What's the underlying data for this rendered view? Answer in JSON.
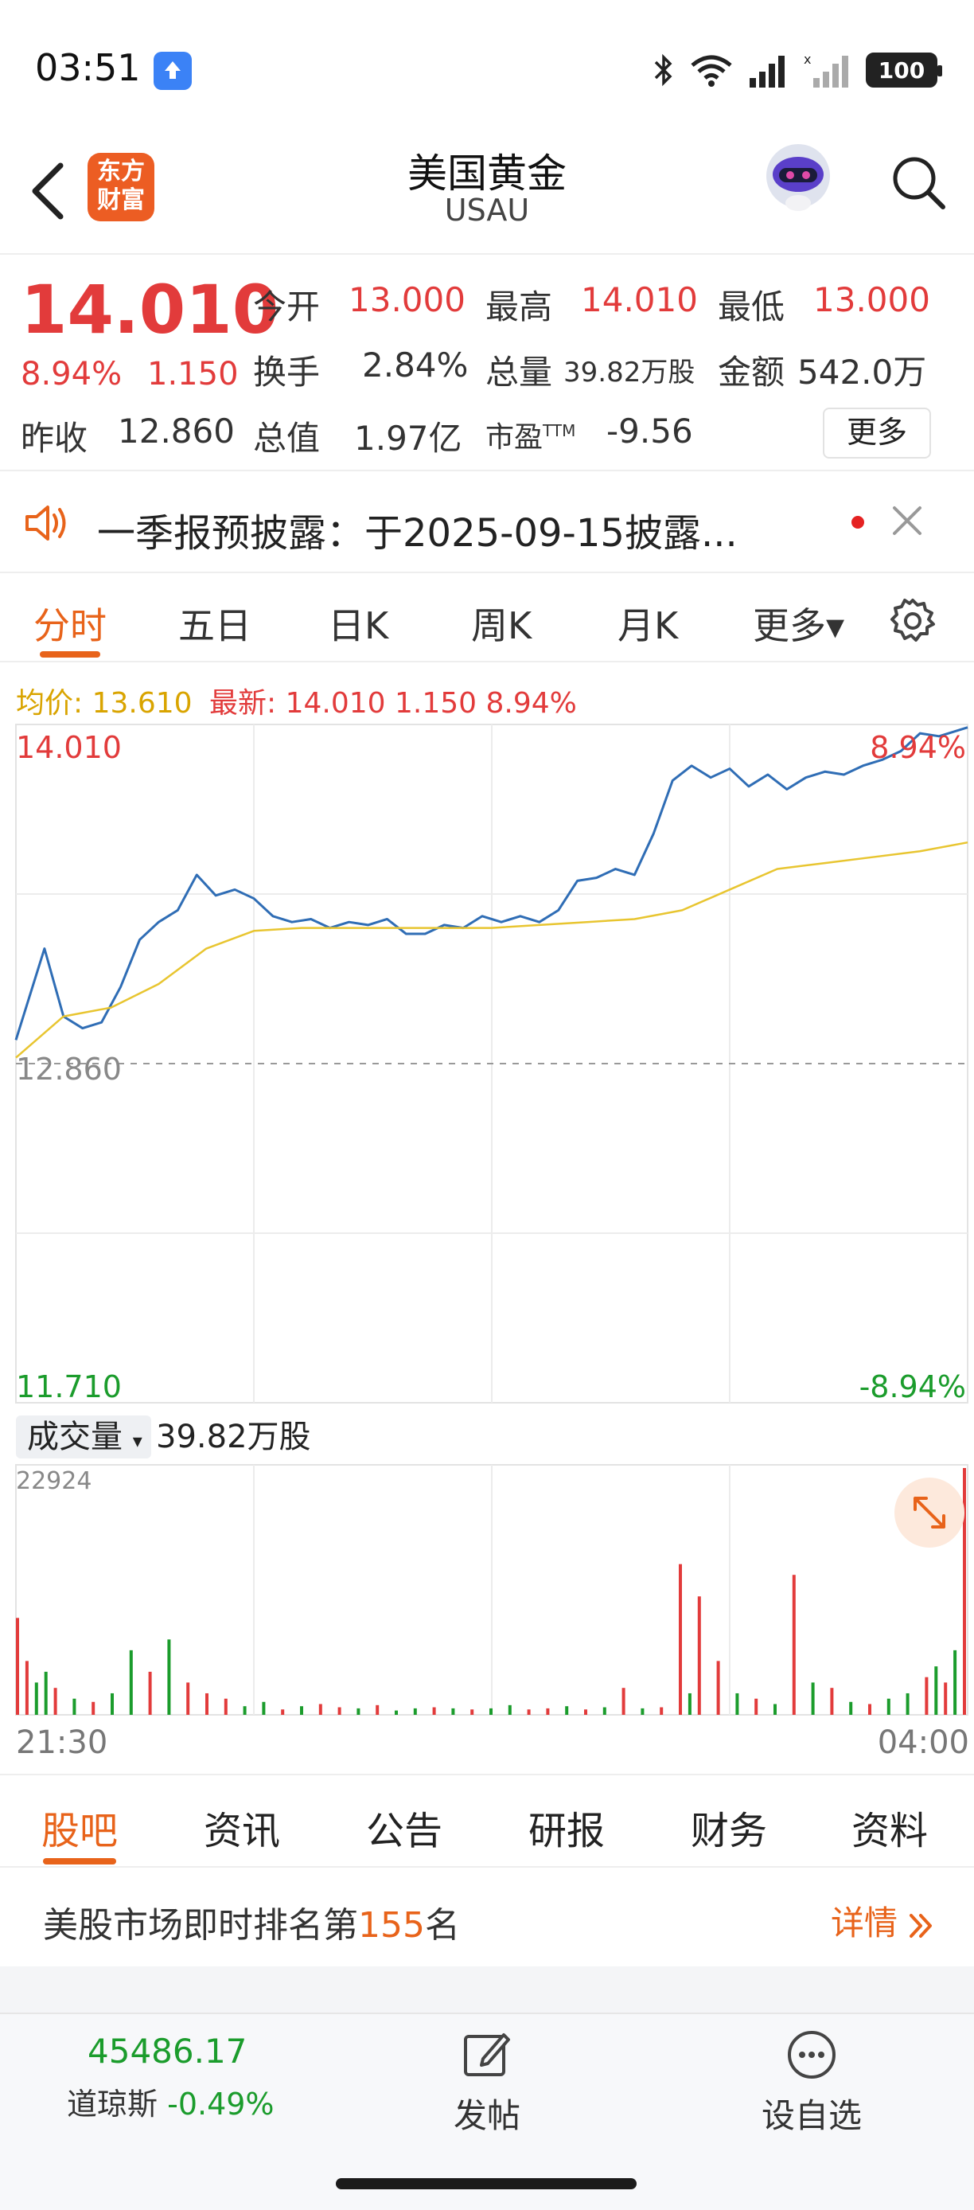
{
  "status_bar": {
    "time": "03:51",
    "battery": "100"
  },
  "header": {
    "title": "美国黄金",
    "subtitle": "USAU",
    "logo_text": "东方财富"
  },
  "quote": {
    "price": "14.010",
    "change_pct": "8.94%",
    "change": "1.150",
    "prev_close_label": "昨收",
    "prev_close": "12.860",
    "open_label": "今开",
    "open": "13.000",
    "high_label": "最高",
    "high": "14.010",
    "low_label": "最低",
    "low": "13.000",
    "turnover_label": "换手",
    "turnover": "2.84%",
    "volume_label": "总量",
    "volume": "39.82万股",
    "amount_label": "金额",
    "amount": "542.0万",
    "market_cap_label": "总值",
    "market_cap": "1.97亿",
    "pe_label": "市盈",
    "pe_sup": "TTM",
    "pe": "-9.56",
    "more_label": "更多"
  },
  "notice": {
    "text": "一季报预披露：于2025-09-15披露..."
  },
  "chart_tabs": [
    "分时",
    "五日",
    "日K",
    "周K",
    "月K",
    "更多▾"
  ],
  "info_line": {
    "avg_label": "均价:",
    "avg": "13.610",
    "latest_label": "最新:",
    "latest": "14.010 1.150 8.94%"
  },
  "colors": {
    "up": "#e23b3b",
    "down": "#1b9c2c",
    "price_line": "#2f6db5",
    "avg_line": "#e8c530",
    "accent": "#e8631a"
  },
  "chart_data": [
    {
      "type": "line",
      "title": "分时",
      "y_labels": {
        "top": "14.010",
        "mid": "12.860",
        "bottom": "11.710",
        "top_pct": "8.94%",
        "bottom_pct": "-8.94%"
      },
      "ylim": [
        11.71,
        14.01
      ],
      "x_labels": [
        "21:30",
        "04:00"
      ],
      "series": [
        {
          "name": "price",
          "x": [
            0,
            3,
            5,
            7,
            9,
            11,
            13,
            15,
            17,
            19,
            21,
            23,
            25,
            27,
            29,
            31,
            33,
            35,
            37,
            39,
            41,
            43,
            45,
            47,
            49,
            51,
            53,
            55,
            57,
            59,
            61,
            63,
            65,
            67,
            69,
            71,
            73,
            75,
            77,
            79,
            81,
            83,
            85,
            87,
            89,
            91,
            93,
            95,
            97,
            100
          ],
          "values": [
            12.94,
            13.25,
            13.02,
            12.98,
            13.0,
            13.12,
            13.28,
            13.34,
            13.38,
            13.5,
            13.43,
            13.45,
            13.42,
            13.36,
            13.34,
            13.35,
            13.32,
            13.34,
            13.33,
            13.35,
            13.3,
            13.3,
            13.33,
            13.32,
            13.36,
            13.34,
            13.36,
            13.34,
            13.38,
            13.48,
            13.49,
            13.52,
            13.5,
            13.64,
            13.82,
            13.87,
            13.83,
            13.86,
            13.8,
            13.84,
            13.79,
            13.83,
            13.85,
            13.84,
            13.87,
            13.89,
            13.92,
            13.98,
            13.97,
            14.0
          ]
        },
        {
          "name": "avg",
          "x": [
            0,
            5,
            10,
            15,
            20,
            25,
            30,
            35,
            40,
            45,
            50,
            55,
            60,
            65,
            70,
            75,
            80,
            85,
            90,
            95,
            100
          ],
          "values": [
            12.88,
            13.02,
            13.05,
            13.13,
            13.25,
            13.31,
            13.32,
            13.32,
            13.32,
            13.32,
            13.32,
            13.33,
            13.34,
            13.35,
            13.38,
            13.45,
            13.52,
            13.54,
            13.56,
            13.58,
            13.61
          ]
        }
      ]
    },
    {
      "type": "bar",
      "title": "成交量",
      "total": "39.82万股",
      "ylim": [
        0,
        22924
      ],
      "y_top_label": "22924",
      "series": [
        {
          "name": "volume",
          "x": [
            0,
            1,
            2,
            3,
            4,
            6,
            8,
            10,
            12,
            14,
            16,
            18,
            20,
            22,
            24,
            26,
            28,
            30,
            32,
            34,
            36,
            38,
            40,
            42,
            44,
            46,
            48,
            50,
            52,
            54,
            56,
            58,
            60,
            62,
            64,
            66,
            68,
            70,
            71,
            72,
            74,
            76,
            78,
            80,
            82,
            84,
            86,
            88,
            90,
            92,
            94,
            96,
            97,
            98,
            99,
            100
          ],
          "values": [
            9000,
            5000,
            3000,
            4000,
            2500,
            1500,
            1200,
            2000,
            6000,
            4000,
            7000,
            3000,
            2000,
            1500,
            800,
            1200,
            500,
            800,
            1000,
            700,
            600,
            900,
            400,
            600,
            700,
            600,
            500,
            600,
            900,
            500,
            600,
            800,
            500,
            700,
            2500,
            600,
            700,
            14000,
            2000,
            11000,
            5000,
            2000,
            1500,
            1000,
            13000,
            3000,
            2500,
            1200,
            1000,
            1500,
            2000,
            3500,
            4500,
            3000,
            6000,
            22924
          ],
          "colors": [
            "up",
            "up",
            "down",
            "down",
            "up",
            "down",
            "up",
            "down",
            "down",
            "up",
            "down",
            "up",
            "up",
            "up",
            "down",
            "down",
            "up",
            "down",
            "up",
            "up",
            "down",
            "up",
            "down",
            "down",
            "up",
            "down",
            "up",
            "down",
            "down",
            "up",
            "up",
            "down",
            "up",
            "down",
            "up",
            "down",
            "up",
            "up",
            "down",
            "up",
            "up",
            "down",
            "up",
            "down",
            "up",
            "down",
            "up",
            "down",
            "up",
            "down",
            "down",
            "up",
            "down",
            "up",
            "down",
            "up"
          ]
        }
      ]
    }
  ],
  "bottom_tabs": [
    "股吧",
    "资讯",
    "公告",
    "研报",
    "财务",
    "资料"
  ],
  "rank": {
    "prefix": "美股市场即时排名第",
    "number": "155",
    "suffix": "名",
    "detail_label": "详情"
  },
  "bottom_bar": {
    "index_value": "45486.17",
    "index_name": "道琼斯",
    "index_change": "-0.49%",
    "post_label": "发帖",
    "favorite_label": "设自选"
  },
  "icons": [
    "upload-icon",
    "bluetooth-icon",
    "wifi-icon",
    "signal-icon",
    "battery-icon",
    "back-icon",
    "robot-avatar-icon",
    "search-icon",
    "speaker-icon",
    "close-icon",
    "gear-icon",
    "expand-icon",
    "double-chevron-right-icon",
    "edit-icon",
    "more-dots-icon"
  ]
}
